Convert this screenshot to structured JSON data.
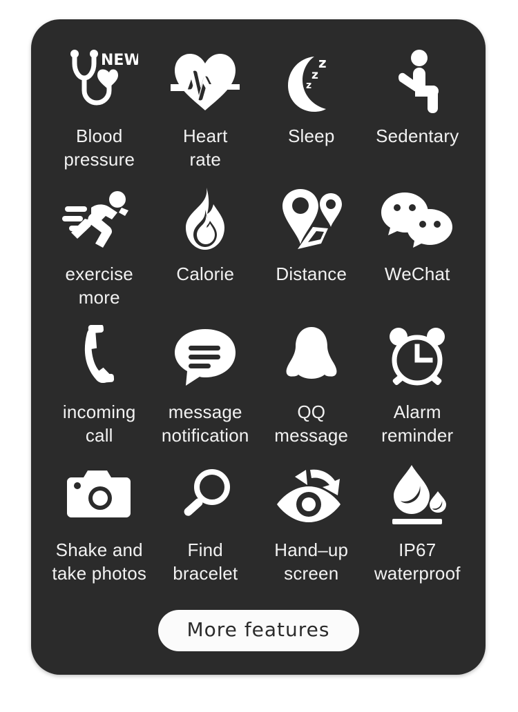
{
  "card": {
    "background_color": "#2b2b2b",
    "text_color": "#f2f2f2"
  },
  "features": [
    {
      "icon": "stethoscope-heart-icon",
      "badge": "NEW",
      "label": "Blood\npressure"
    },
    {
      "icon": "heart-pulse-icon",
      "badge": "",
      "label": "Heart\nrate"
    },
    {
      "icon": "moon-zzz-icon",
      "badge": "",
      "label": "Sleep"
    },
    {
      "icon": "sitting-person-icon",
      "badge": "",
      "label": "Sedentary"
    },
    {
      "icon": "running-person-icon",
      "badge": "",
      "label": "exercise\nmore"
    },
    {
      "icon": "flame-icon",
      "badge": "",
      "label": "Calorie"
    },
    {
      "icon": "map-pin-route-icon",
      "badge": "",
      "label": "Distance"
    },
    {
      "icon": "wechat-bubbles-icon",
      "badge": "",
      "label": "WeChat"
    },
    {
      "icon": "phone-handset-icon",
      "badge": "",
      "label": "incoming\ncall"
    },
    {
      "icon": "message-bubble-icon",
      "badge": "",
      "label": "message\nnotification"
    },
    {
      "icon": "qq-penguin-icon",
      "badge": "",
      "label": "QQ\nmessage"
    },
    {
      "icon": "alarm-clock-icon",
      "badge": "",
      "label": "Alarm\nreminder"
    },
    {
      "icon": "camera-icon",
      "badge": "",
      "label": "Shake and\ntake photos"
    },
    {
      "icon": "magnifier-icon",
      "badge": "",
      "label": "Find\nbracelet"
    },
    {
      "icon": "eye-raise-icon",
      "badge": "",
      "label": "Hand–up\nscreen"
    },
    {
      "icon": "water-drop-icon",
      "badge": "",
      "label": "IP67\nwaterproof"
    }
  ],
  "more_button": {
    "label": "More features"
  }
}
